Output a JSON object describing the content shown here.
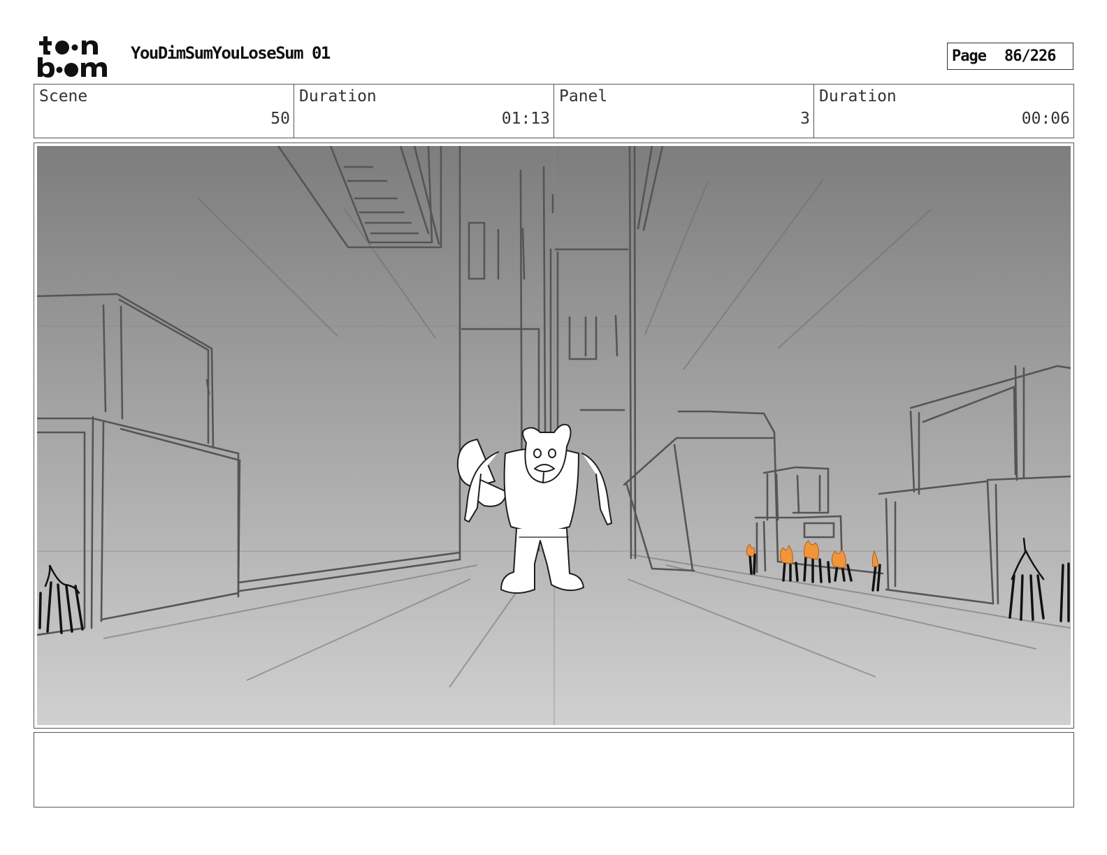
{
  "header": {
    "logo_text": "toon boom",
    "project_title": "YouDimSumYouLoseSum 01",
    "page_label": "Page",
    "page_number": "86/226"
  },
  "info": {
    "scene_label": "Scene",
    "scene_value": "50",
    "scene_duration_label": "Duration",
    "scene_duration_value": "01:13",
    "panel_label": "Panel",
    "panel_value": "3",
    "panel_duration_label": "Duration",
    "panel_duration_value": "00:06"
  },
  "colors": {
    "sketch_line": "#5a5a5a",
    "flame_orange": "#f0953a",
    "sky_top": "#7d7d7d",
    "ground_bottom": "#d0d0d0"
  },
  "notes": {
    "text": ""
  }
}
